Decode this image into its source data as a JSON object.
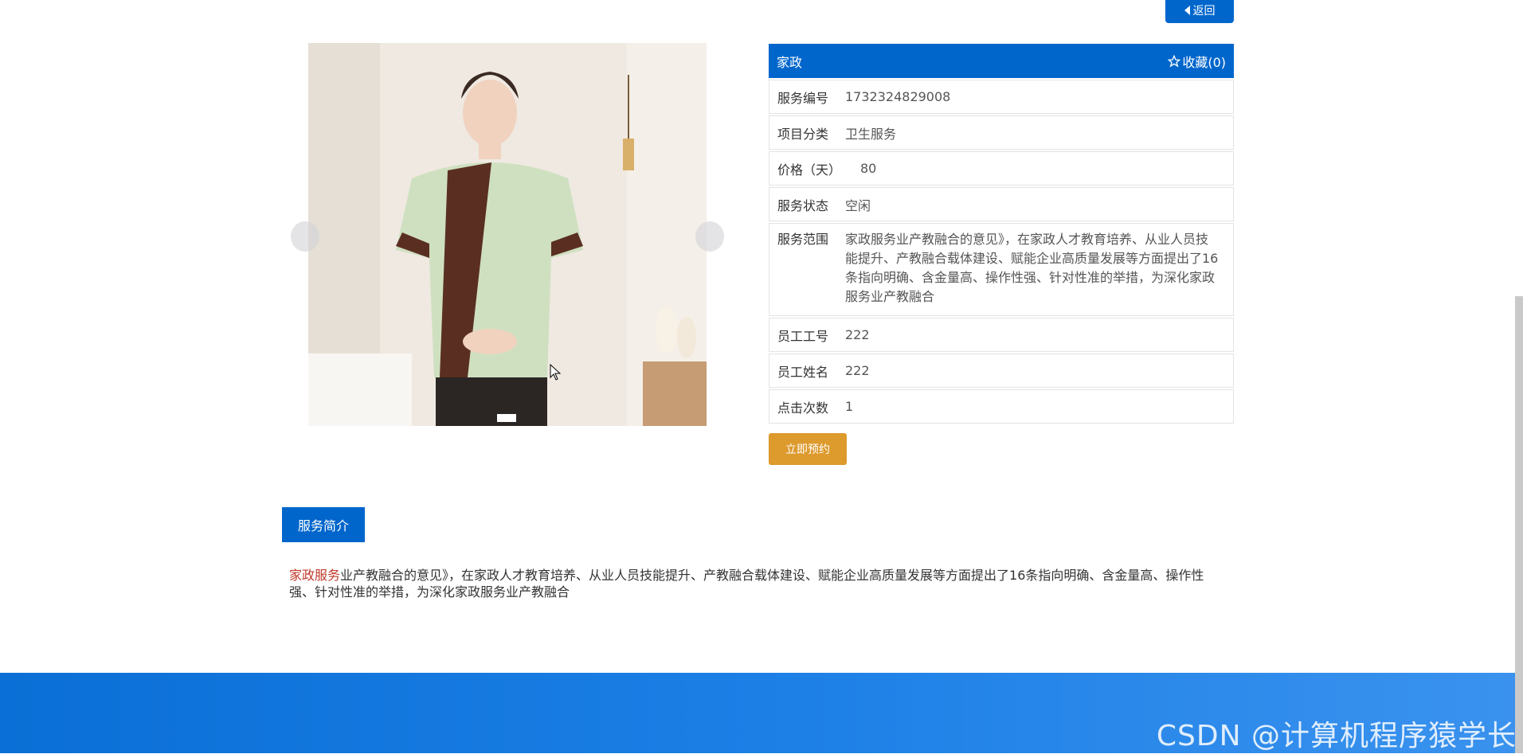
{
  "back_button": {
    "label": "返回"
  },
  "carousel": {
    "image_alt": "家政服务人员照片"
  },
  "detail": {
    "title": "家政",
    "favorite_label": "收藏(0)",
    "rows": [
      {
        "label": "服务编号",
        "value": "1732324829008"
      },
      {
        "label": "项目分类",
        "value": "卫生服务"
      },
      {
        "label": "价格（天）",
        "value": "80"
      },
      {
        "label": "服务状态",
        "value": "空闲"
      },
      {
        "label": "服务范围",
        "value": "家政服务业产教融合的意见》，在家政人才教育培养、从业人员技能提升、产教融合载体建设、赋能企业高质量发展等方面提出了16条指向明确、含金量高、操作性强、针对性准的举措，为深化家政服务业产教融合"
      },
      {
        "label": "员工工号",
        "value": "222"
      },
      {
        "label": "员工姓名",
        "value": "222"
      },
      {
        "label": "点击次数",
        "value": "1"
      }
    ]
  },
  "book_button": {
    "label": "立即预约"
  },
  "intro": {
    "tab_label": "服务简介",
    "highlight": "家政服务",
    "text": "业产教融合的意见》，在家政人才教育培养、从业人员技能提升、产教融合载体建设、赋能企业高质量发展等方面提出了16条指向明确、含金量高、操作性强、针对性准的举措，为深化家政服务业产教融合"
  },
  "watermark": "CSDN @计算机程序猿学长",
  "colors": {
    "primary": "#0066cc",
    "accent": "#dd9a2d"
  }
}
